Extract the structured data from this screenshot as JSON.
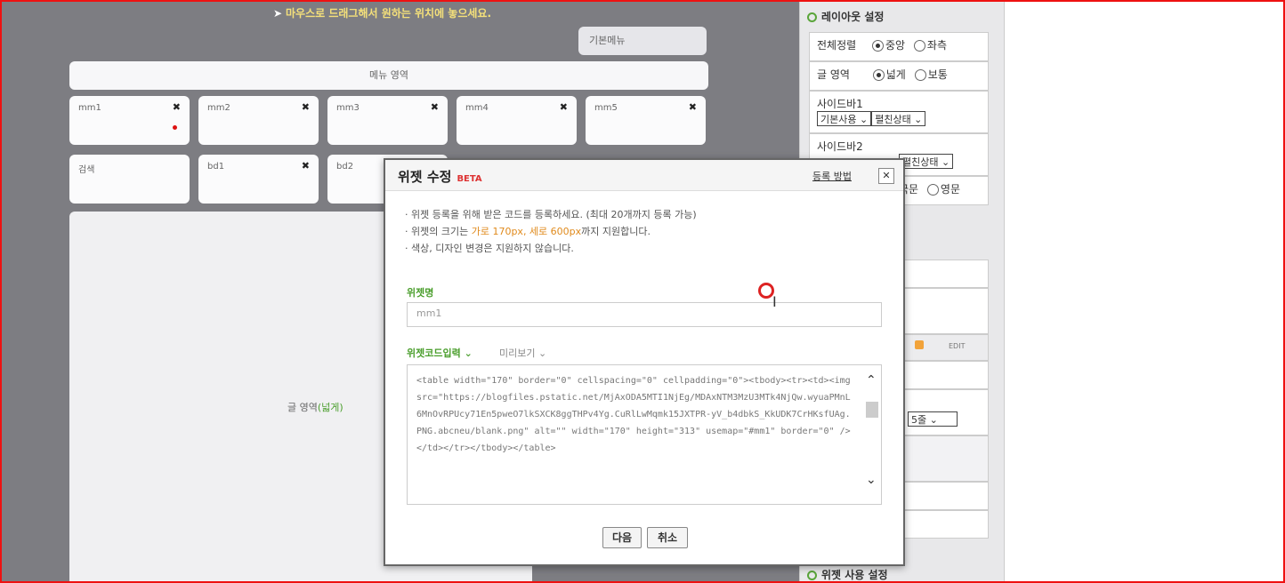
{
  "canvas": {
    "hint": "마우스로 드래그해서 원하는 위치에 놓으세요.",
    "default_button": "기본메뉴",
    "menu_bar": "메뉴 영역",
    "tiles_row1": [
      {
        "label": "mm1",
        "close": "✖"
      },
      {
        "label": "mm2",
        "close": "✖"
      },
      {
        "label": "mm3",
        "close": "✖"
      },
      {
        "label": "mm4",
        "close": "✖"
      },
      {
        "label": "mm5",
        "close": "✖"
      }
    ],
    "tiles_row2": [
      {
        "label": "검색",
        "close": ""
      },
      {
        "label": "bd1",
        "close": "✖"
      },
      {
        "label": "bd2",
        "close": ""
      }
    ],
    "content_label": "글 영역",
    "content_label_highlight": "(넓게)"
  },
  "layout_panel": {
    "title": "레이아웃 설정",
    "align_label": "전체정렬",
    "align_opt1": "중앙",
    "align_opt2": "좌측",
    "text_label": "글 영역",
    "text_opt1": "넓게",
    "text_opt2": "보통",
    "sidebar1_label": "사이드바1",
    "sidebar1_sel1": "기본사용",
    "sidebar1_sel2": "펼친상태",
    "sidebar2_label": "사이드바2",
    "sidebar2_sel2": "펼친상태",
    "lang_opt1": "국문",
    "lang_opt2": "영문",
    "edit_label": "EDIT",
    "count_select": "5줄",
    "bottom_title": "위젯 사용 설정"
  },
  "modal": {
    "title": "위젯 수정",
    "beta": "BETA",
    "help_link": "등록 방법",
    "close": "✕",
    "notes": [
      "· 위젯 등록을 위해 받은 코드를 등록하세요. (최대 20개까지 등록 가능)",
      "· 위젯의 크기는 가로 170px, 세로 600px까지 지원합니다.",
      "· 색상, 디자인 변경은 지원하지 않습니다."
    ],
    "note2_pre": "· 위젯의 크기는 ",
    "note2_hl": "가로 170px, 세로 600px",
    "note2_post": "까지 지원합니다.",
    "name_label": "위젯명",
    "name_value": "mm1",
    "code_tab": "위젯코드입력",
    "preview_tab": "미리보기",
    "code_value": "<table width=\"170\" border=\"0\" cellspacing=\"0\" cellpadding=\"0\"><tbody><tr><td><img src=\"https://blogfiles.pstatic.net/MjAxODA5MTI1NjEg/MDAxNTM3MzU3MTk4NjQw.wyuaPMnL6MnOvRPUcy71En5pweO7lkSXCK8ggTHPv4Yg.CuRlLwMqmk15JXTPR-yV_b4dbkS_KkUDK7CrHKsfUAg.PNG.abcneu/blank.png\" alt=\"\" width=\"170\" height=\"313\" usemap=\"#mm1\" border=\"0\" /></td></tr></tbody></table>",
    "next_button": "다음",
    "cancel_button": "취소"
  }
}
